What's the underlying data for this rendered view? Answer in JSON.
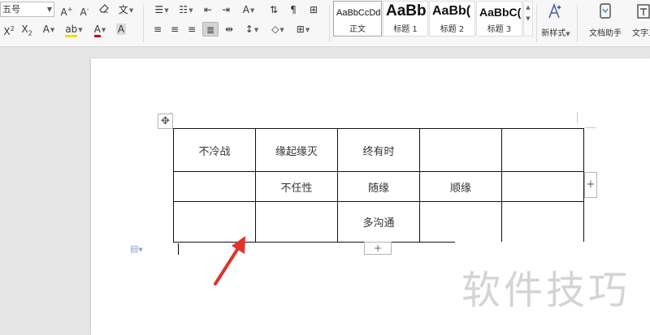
{
  "ribbon": {
    "font_size_value": "五号",
    "style_gallery": [
      {
        "sample": "AaBbCcDd",
        "name": "正文"
      },
      {
        "sample": "AaBb",
        "name": "标题 1"
      },
      {
        "sample": "AaBb(",
        "name": "标题 2"
      },
      {
        "sample": "AaBbC(",
        "name": "标题 3"
      }
    ],
    "new_style_label": "新样式",
    "doc_assistant_label": "文档助手",
    "text_tool_label": "文字工"
  },
  "table": {
    "rows": [
      [
        "不冷战",
        "缘起缘灭",
        "终有时",
        "",
        ""
      ],
      [
        "",
        "不任性",
        "随缘",
        "顺缘",
        ""
      ],
      [
        "",
        "",
        "多沟通",
        "",
        ""
      ]
    ]
  },
  "controls": {
    "add_column": "+",
    "add_row": "+",
    "table_move": "✥"
  },
  "watermark": "软件技巧",
  "colors": {
    "arrow": "#e0332b",
    "font_color_underline": "#d00000",
    "highlight_underline": "#f0e000"
  }
}
